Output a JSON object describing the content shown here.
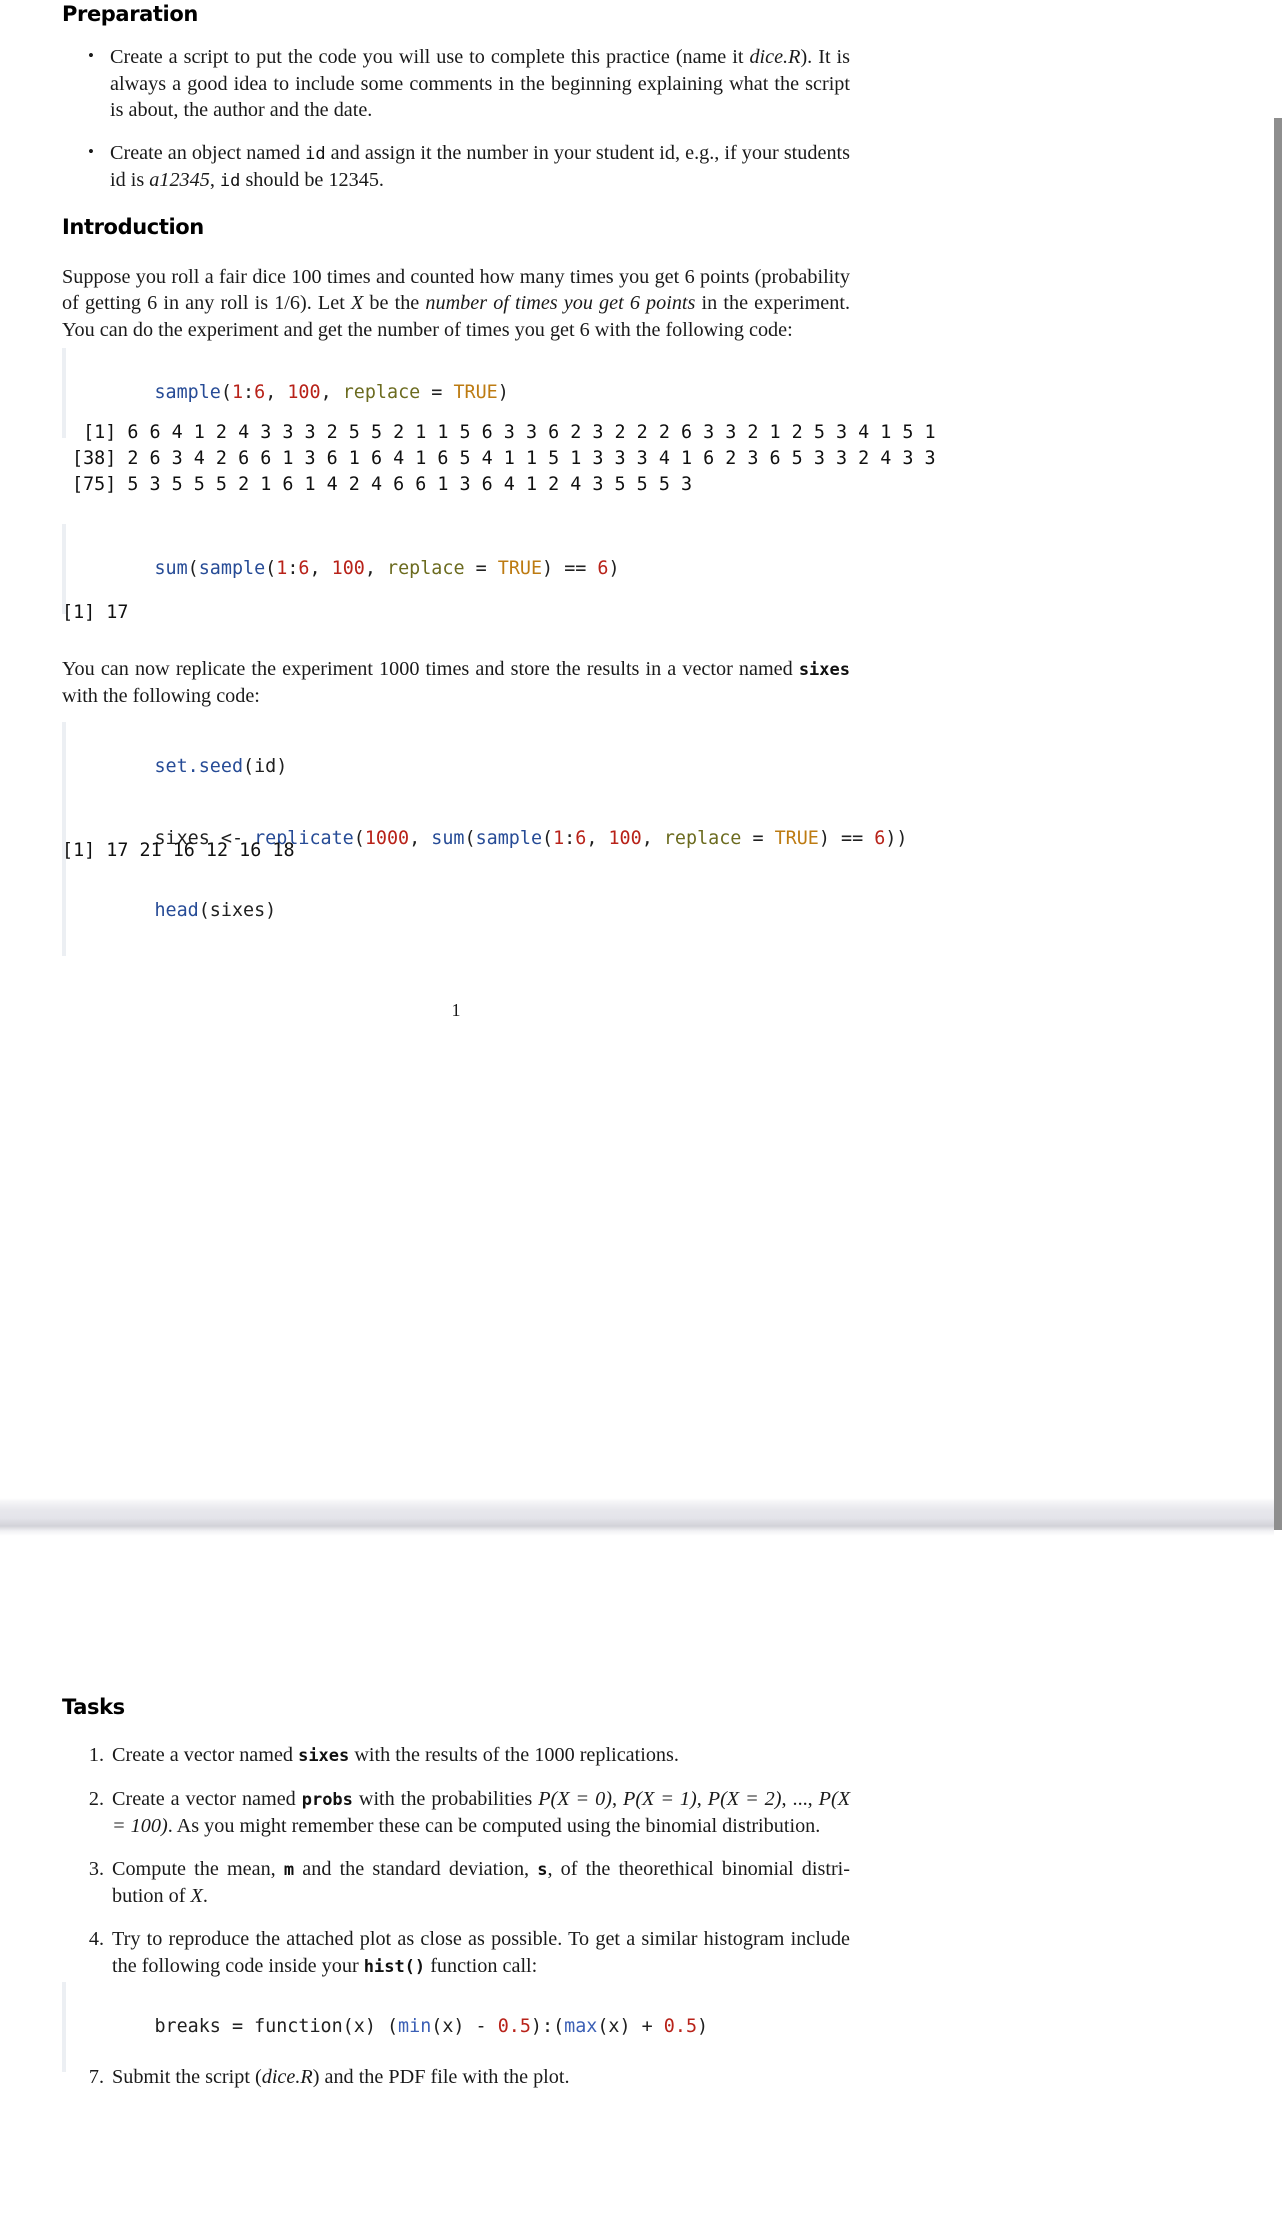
{
  "document": {
    "page_number": "1"
  },
  "sections": {
    "preparation": {
      "heading": "Preparation",
      "bullets": [
        {
          "line1_a": "Create a script to put the code you will use to complete this practice (name it ",
          "line1_em": "dice.R",
          "line1_b": ").",
          "line2": "It is always a good idea to include some comments in the beginning explaining what the",
          "line3": "script is about, the author and the date."
        },
        {
          "line1_a": "Create an object named ",
          "line1_code": "id",
          "line1_b": " and assign it the number in your student id, e.g., if your",
          "line2_a": "students id is ",
          "line2_em": "a12345",
          "line2_b": ", ",
          "line2_code": "id",
          "line2_c": " should be 12345."
        }
      ]
    },
    "introduction": {
      "heading": "Introduction",
      "paragraph": {
        "line1": "Suppose you roll a fair dice 100 times and counted how many times you get 6 points (probability",
        "line2_a": "of getting 6 in any roll is 1/6).  Let ",
        "line2_math": "X",
        "line2_b": " be the ",
        "line2_em": "number of times you get 6 points",
        "line2_c": " in the experiment.",
        "line3": "You can do the experiment and get the number of times you get 6 with the following code:"
      },
      "code_sample": {
        "tokens": [
          {
            "text": "sample",
            "style": "fn"
          },
          {
            "text": "(",
            "style": "plain"
          },
          {
            "text": "1",
            "style": "num"
          },
          {
            "text": ":",
            "style": "plain"
          },
          {
            "text": "6",
            "style": "num"
          },
          {
            "text": ", ",
            "style": "plain"
          },
          {
            "text": "100",
            "style": "num"
          },
          {
            "text": ", ",
            "style": "plain"
          },
          {
            "text": "replace",
            "style": "arg"
          },
          {
            "text": " = ",
            "style": "plain"
          },
          {
            "text": "TRUE",
            "style": "const"
          },
          {
            "text": ")",
            "style": "plain"
          }
        ]
      },
      "output_sample": [
        " [1] 6 6 4 1 2 4 3 3 3 2 5 5 2 1 1 5 6 3 3 6 2 3 2 2 2 6 3 3 2 1 2 5 3 4 1 5 1",
        "[38] 2 6 3 4 2 6 6 1 3 6 1 6 4 1 6 5 4 1 1 5 1 3 3 3 4 1 6 2 3 6 5 3 3 2 4 3 3",
        "[75] 5 3 5 5 5 2 1 6 1 4 2 4 6 6 1 3 6 4 1 2 4 3 5 5 5 3"
      ],
      "code_sum": {
        "tokens": [
          {
            "text": "sum",
            "style": "fn"
          },
          {
            "text": "(",
            "style": "plain"
          },
          {
            "text": "sample",
            "style": "fn"
          },
          {
            "text": "(",
            "style": "plain"
          },
          {
            "text": "1",
            "style": "num"
          },
          {
            "text": ":",
            "style": "plain"
          },
          {
            "text": "6",
            "style": "num"
          },
          {
            "text": ", ",
            "style": "plain"
          },
          {
            "text": "100",
            "style": "num"
          },
          {
            "text": ", ",
            "style": "plain"
          },
          {
            "text": "replace",
            "style": "arg"
          },
          {
            "text": " = ",
            "style": "plain"
          },
          {
            "text": "TRUE",
            "style": "const"
          },
          {
            "text": ")",
            "style": "plain"
          },
          {
            "text": " == ",
            "style": "plain"
          },
          {
            "text": "6",
            "style": "num"
          },
          {
            "text": ")",
            "style": "plain"
          }
        ]
      },
      "output_sum": "[1] 17",
      "paragraph2": {
        "line1_a": "You can now replicate the experiment 1000 times and store the results in a vector named ",
        "line1_code": "sixes",
        "line2": "with the following code:"
      },
      "code_replicate": {
        "lines": [
          [
            {
              "text": "set.seed",
              "style": "fn"
            },
            {
              "text": "(id)",
              "style": "plain"
            }
          ],
          [
            {
              "text": "sixes ",
              "style": "plain"
            },
            {
              "text": "<-",
              "style": "plain"
            },
            {
              "text": " ",
              "style": "plain"
            },
            {
              "text": "replicate",
              "style": "fn"
            },
            {
              "text": "(",
              "style": "plain"
            },
            {
              "text": "1000",
              "style": "num"
            },
            {
              "text": ", ",
              "style": "plain"
            },
            {
              "text": "sum",
              "style": "fn"
            },
            {
              "text": "(",
              "style": "plain"
            },
            {
              "text": "sample",
              "style": "fn"
            },
            {
              "text": "(",
              "style": "plain"
            },
            {
              "text": "1",
              "style": "num"
            },
            {
              "text": ":",
              "style": "plain"
            },
            {
              "text": "6",
              "style": "num"
            },
            {
              "text": ", ",
              "style": "plain"
            },
            {
              "text": "100",
              "style": "num"
            },
            {
              "text": ", ",
              "style": "plain"
            },
            {
              "text": "replace",
              "style": "arg"
            },
            {
              "text": " = ",
              "style": "plain"
            },
            {
              "text": "TRUE",
              "style": "const"
            },
            {
              "text": ")",
              "style": "plain"
            },
            {
              "text": " == ",
              "style": "plain"
            },
            {
              "text": "6",
              "style": "num"
            },
            {
              "text": "))",
              "style": "plain"
            }
          ],
          [
            {
              "text": "head",
              "style": "fn"
            },
            {
              "text": "(sixes)",
              "style": "plain"
            }
          ]
        ]
      },
      "output_head": "[1] 17 21 16 12 16 18"
    },
    "tasks": {
      "heading": "Tasks",
      "items": [
        {
          "number": "1.",
          "line1_a": "Create a vector named ",
          "line1_code": "sixes",
          "line1_b": " with the results of the 1000 replications."
        },
        {
          "number": "2.",
          "line1_a": "Create a vector named ",
          "line1_code": "probs",
          "line1_b": " with the probabilities ",
          "line1_math1": "P(X = 0)",
          "line1_c": ", ",
          "line1_math2": "P(X = 1)",
          "line1_d": ", ",
          "line1_math3": "P(X = 2)",
          "line1_e": ",",
          "line2_a": "..., ",
          "line2_math": "P(X = 100)",
          "line2_b": ".  As you might remember these can be computed using the binomial",
          "line3": "distribution."
        },
        {
          "number": "3.",
          "line1_a": "Compute the mean, ",
          "line1_code1": "m",
          "line1_b": " and the standard deviation, ",
          "line1_code2": "s",
          "line1_c": ", of the theorethical binomial distri-",
          "line2_a": "bution of ",
          "line2_math": "X",
          "line2_b": "."
        },
        {
          "number": "4.",
          "line1": "Try to reproduce the attached plot as close as possible.  To get a similar histogram include",
          "line2_a": "the following code inside your ",
          "line2_code": "hist()",
          "line2_b": " function call:"
        }
      ],
      "code_breaks": {
        "tokens": [
          {
            "text": "breaks = ",
            "style": "plain"
          },
          {
            "text": "function",
            "style": "plain"
          },
          {
            "text": "(x) (",
            "style": "plain"
          },
          {
            "text": "min",
            "style": "fn2"
          },
          {
            "text": "(x) ",
            "style": "plain"
          },
          {
            "text": "-",
            "style": "plain"
          },
          {
            "text": " ",
            "style": "plain"
          },
          {
            "text": "0.5",
            "style": "num"
          },
          {
            "text": "):(",
            "style": "plain"
          },
          {
            "text": "max",
            "style": "fn2"
          },
          {
            "text": "(x) ",
            "style": "plain"
          },
          {
            "text": "+",
            "style": "plain"
          },
          {
            "text": " ",
            "style": "plain"
          },
          {
            "text": "0.5",
            "style": "num"
          },
          {
            "text": ")",
            "style": "plain"
          }
        ]
      },
      "final_item": {
        "number": "7.",
        "line1_a": "Submit the script (",
        "line1_em": "dice.R",
        "line1_b": ") and the PDF file with the plot."
      }
    }
  }
}
